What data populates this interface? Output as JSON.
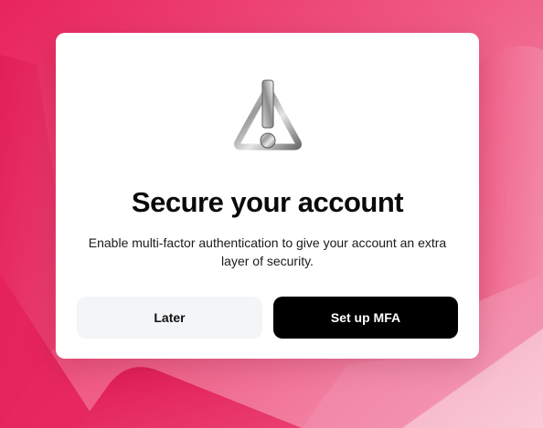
{
  "dialog": {
    "icon": "warning-icon",
    "title": "Secure your account",
    "description": "Enable multi-factor authentication to give your account an extra layer of security.",
    "secondary_label": "Later",
    "primary_label": "Set up MFA"
  },
  "colors": {
    "background_accent": "#e8245c",
    "primary_button": "#000000",
    "secondary_button": "#f4f5f7"
  }
}
